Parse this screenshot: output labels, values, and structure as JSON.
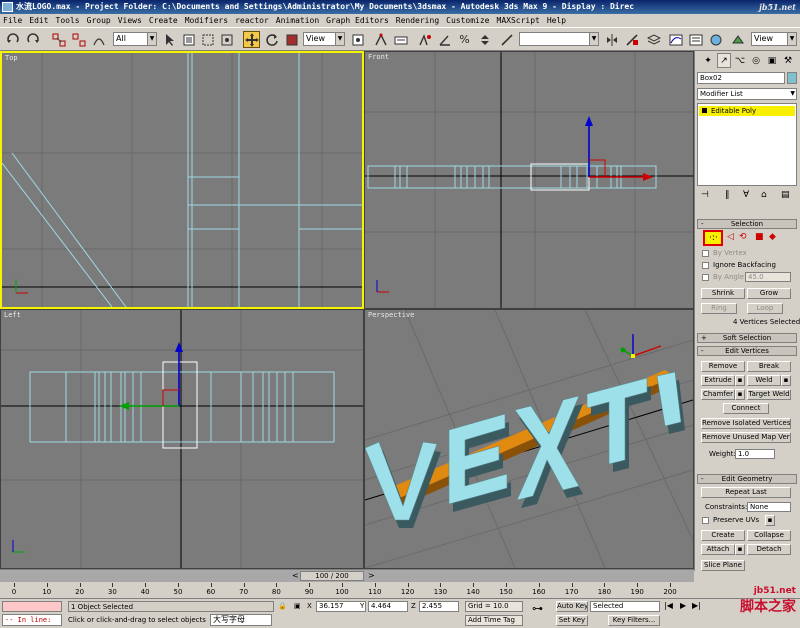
{
  "window": {
    "title": "水流LOGO.max    - Project Folder: C:\\Documents and Settings\\Administrator\\My Documents\\3dsmax    - Autodesk 3ds Max 9    - Display : Direc",
    "watermark_text": "jb51.net"
  },
  "menu": [
    "File",
    "Edit",
    "Tools",
    "Group",
    "Views",
    "Create",
    "Modifiers",
    "reactor",
    "Animation",
    "Graph Editors",
    "Rendering",
    "Customize",
    "MAXScript",
    "Help"
  ],
  "toolbar": {
    "selection_filter": "All",
    "ref_coord": "View",
    "named_selection": "",
    "render_preset": "View"
  },
  "viewports": {
    "top": {
      "label": "Top"
    },
    "front": {
      "label": "Front"
    },
    "left": {
      "label": "Left"
    },
    "perspective": {
      "label": "Perspective"
    }
  },
  "colors": {
    "viewport_bg": "#7b7b7b",
    "grid": "#6a6a6a",
    "wire": "#9fd9e6",
    "active_border": "#f5f500",
    "gizmo_x": "#d00000",
    "gizmo_y": "#00a000",
    "gizmo_z": "#0000d0",
    "logo_face": "#9ee0ea",
    "logo_side": "#3a5a60",
    "bar_orange": "#e08a10"
  },
  "command_panel": {
    "object_name": "Box02",
    "modifier_list": "Modifier List",
    "stack_item": "Editable Poly",
    "selection": {
      "title": "Selection",
      "by_vertex": "By Vertex",
      "ignore_backfacing": "Ignore Backfacing",
      "by_angle": "By Angle:",
      "angle_value": "45.0",
      "shrink": "Shrink",
      "grow": "Grow",
      "ring": "Ring",
      "loop": "Loop",
      "status": "4 Vertices Selected"
    },
    "soft_selection": {
      "title": "Soft Selection"
    },
    "edit_vertices": {
      "title": "Edit Vertices",
      "remove": "Remove",
      "break": "Break",
      "extrude": "Extrude",
      "weld": "Weld",
      "chamfer": "Chamfer",
      "target_weld": "Target Weld",
      "connect": "Connect",
      "remove_isolated": "Remove Isolated Vertices",
      "remove_unused_map": "Remove Unused Map Verts",
      "weight_label": "Weight:",
      "weight_value": "1.0"
    },
    "edit_geometry": {
      "title": "Edit Geometry",
      "repeat_last": "Repeat Last",
      "constraints_label": "Constraints:",
      "constraints_value": "None",
      "preserve_uvs": "Preserve UVs",
      "create": "Create",
      "collapse": "Collapse",
      "attach": "Attach",
      "detach": "Detach",
      "slice_plane": "Slice Plane"
    }
  },
  "timeline": {
    "slider": "100 / 200",
    "ticks": [
      "0",
      "10",
      "20",
      "30",
      "40",
      "50",
      "60",
      "70",
      "80",
      "90",
      "100",
      "110",
      "120",
      "130",
      "140",
      "150",
      "160",
      "170",
      "180",
      "190",
      "200"
    ]
  },
  "status": {
    "selection": "1 Object Selected",
    "prompt": "Click or click-and-drag to select objects",
    "ime": "大写字母",
    "x_label": "X",
    "x": "36.157",
    "y_label": "Y",
    "y": "4.464",
    "z_label": "Z",
    "z": "2.455",
    "grid": "Grid = 10.0",
    "add_time_tag": "Add Time Tag",
    "auto_key": "Auto Key",
    "set_key": "Set Key",
    "key_mode": "Selected",
    "key_filters": "Key Filters...",
    "maxscript_prompt": "-- In line:"
  },
  "site_watermark": {
    "url": "jb51.net",
    "name": "脚本之家"
  }
}
